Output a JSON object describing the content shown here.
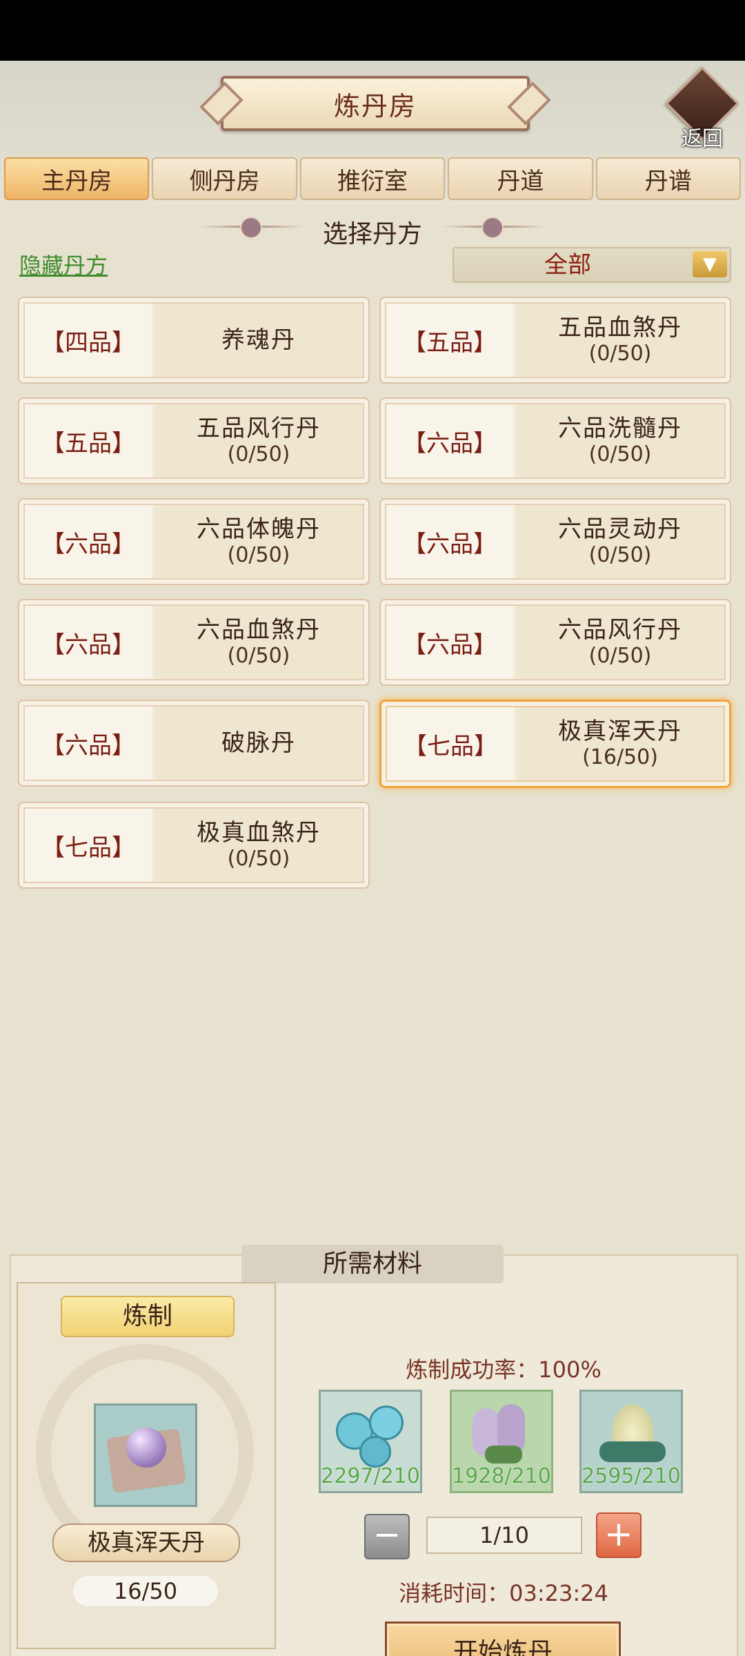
{
  "header": {
    "title": "炼丹房",
    "back_label": "返回"
  },
  "tabs": [
    {
      "label": "主丹房",
      "active": true
    },
    {
      "label": "侧丹房",
      "active": false
    },
    {
      "label": "推衍室",
      "active": false
    },
    {
      "label": "丹道",
      "active": false
    },
    {
      "label": "丹谱",
      "active": false
    }
  ],
  "select": {
    "title": "选择丹方",
    "hidden_link": "隐藏丹方",
    "filter_value": "全部"
  },
  "recipes": [
    {
      "grade": "【四品】",
      "name": "养魂丹",
      "progress": ""
    },
    {
      "grade": "【五品】",
      "name": "五品血煞丹",
      "progress": "(0/50)"
    },
    {
      "grade": "【五品】",
      "name": "五品风行丹",
      "progress": "(0/50)"
    },
    {
      "grade": "【六品】",
      "name": "六品洗髓丹",
      "progress": "(0/50)"
    },
    {
      "grade": "【六品】",
      "name": "六品体魄丹",
      "progress": "(0/50)"
    },
    {
      "grade": "【六品】",
      "name": "六品灵动丹",
      "progress": "(0/50)"
    },
    {
      "grade": "【六品】",
      "name": "六品血煞丹",
      "progress": "(0/50)"
    },
    {
      "grade": "【六品】",
      "name": "六品风行丹",
      "progress": "(0/50)"
    },
    {
      "grade": "【六品】",
      "name": "破脉丹",
      "progress": ""
    },
    {
      "grade": "【七品】",
      "name": "极真浑天丹",
      "progress": "(16/50)",
      "selected": true
    },
    {
      "grade": "【七品】",
      "name": "极真血煞丹",
      "progress": "(0/50)"
    }
  ],
  "materials": {
    "section_title": "所需材料",
    "craft_label": "炼制",
    "selected_pill_name": "极真浑天丹",
    "selected_pill_count": "16/50",
    "success_rate": "炼制成功率：100%",
    "items": [
      {
        "icon": "blue-flower-icon",
        "count": "2297/210"
      },
      {
        "icon": "lavender-herb-icon",
        "count": "1928/210"
      },
      {
        "icon": "jade-cone-icon",
        "count": "2595/210"
      }
    ],
    "quantity": "1/10",
    "time_cost": "消耗时间：03:23:24",
    "start_label": "开始炼丹"
  },
  "colors": {
    "accent": "#efb466",
    "selected_border": "#f0a43a",
    "success_green": "#5aa84a"
  }
}
